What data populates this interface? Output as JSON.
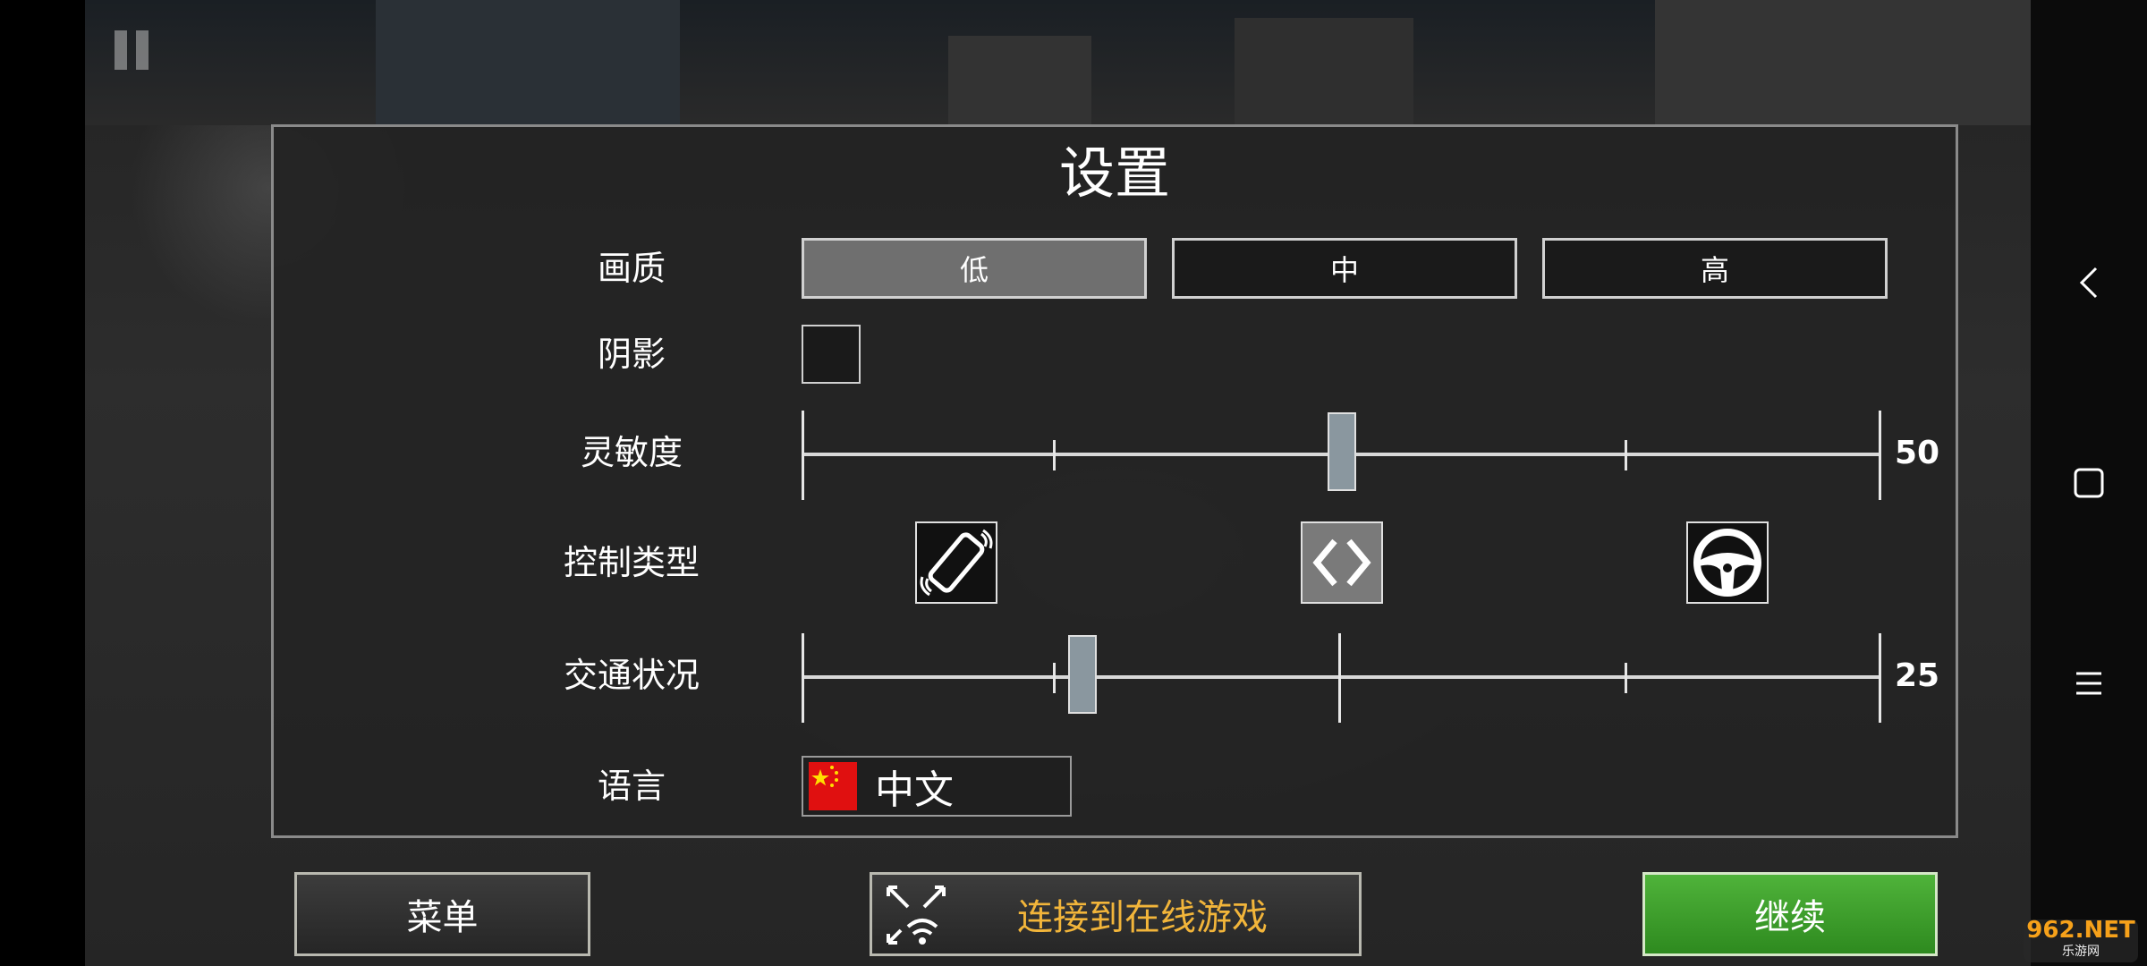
{
  "hud": {
    "pause_icon": "pause-icon",
    "camera_icon": "camera-icon"
  },
  "settings": {
    "title": "设置",
    "quality": {
      "label": "画质",
      "options": [
        "低",
        "中",
        "高"
      ],
      "selected": "低"
    },
    "shadow": {
      "label": "阴影",
      "checked": false
    },
    "sensitivity": {
      "label": "灵敏度",
      "value": "50",
      "fraction": 0.5
    },
    "control_type": {
      "label": "控制类型",
      "options": [
        {
          "icon": "tilt-phone-icon",
          "active": false
        },
        {
          "icon": "arrows-icon",
          "active": true
        },
        {
          "icon": "steering-wheel-icon",
          "active": false
        }
      ]
    },
    "traffic": {
      "label": "交通状况",
      "value": "25",
      "fraction": 0.26
    },
    "language": {
      "label": "语言",
      "value": "中文",
      "flag_icon": "china-flag-icon"
    }
  },
  "buttons": {
    "menu": "菜单",
    "online": "连接到在线游戏",
    "continue": "继续"
  },
  "colors": {
    "continue_green": "#3ea42a",
    "online_text": "#f2b53a",
    "slider_handle": "#8a979f"
  },
  "system_nav": {
    "back": "back-icon",
    "home": "home-square-icon",
    "recents": "menu-lines-icon"
  },
  "watermark": {
    "brand": "962.NET",
    "sub": "乐游网"
  }
}
